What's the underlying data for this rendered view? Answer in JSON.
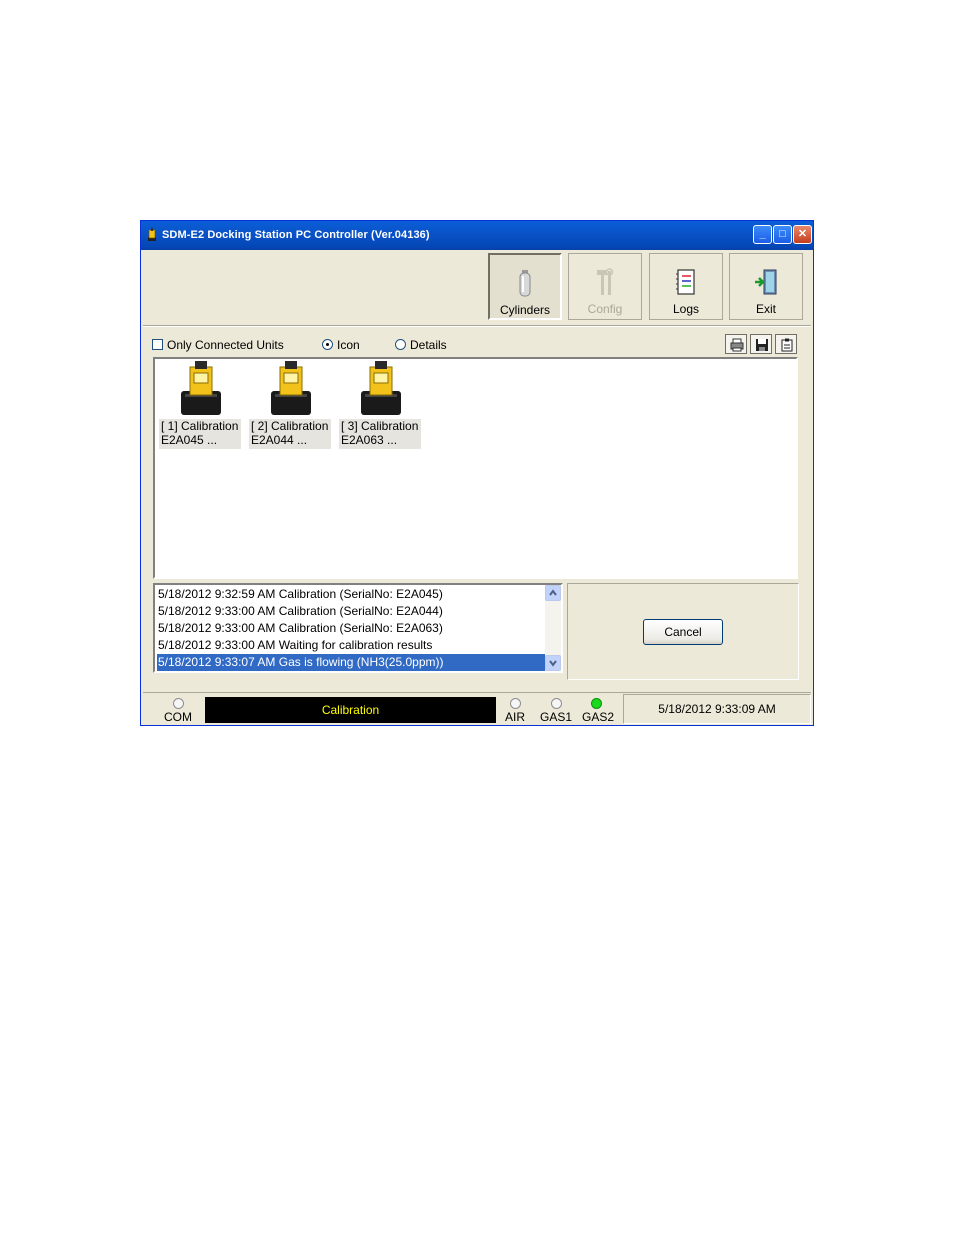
{
  "window": {
    "title": "SDM-E2 Docking Station PC Controller (Ver.04136)",
    "controls": [
      "minimize",
      "maximize",
      "close"
    ]
  },
  "toolbar": {
    "buttons": [
      {
        "label": "Cylinders",
        "icon": "cylinder-icon",
        "state": "pressed"
      },
      {
        "label": "Config",
        "icon": "tools-icon",
        "state": "disabled"
      },
      {
        "label": "Logs",
        "icon": "logbook-icon",
        "state": "normal"
      },
      {
        "label": "Exit",
        "icon": "exit-door-icon",
        "state": "normal"
      }
    ]
  },
  "view_options": {
    "only_connected": {
      "label": "Only Connected Units",
      "checked": false
    },
    "icon": {
      "label": "Icon",
      "selected": true
    },
    "details": {
      "label": "Details",
      "selected": false
    },
    "actions": [
      "print-icon",
      "save-icon",
      "clipboard-icon"
    ]
  },
  "units": [
    {
      "line1": "[ 1] Calibration",
      "line2": "E2A045     ..."
    },
    {
      "line1": "[ 2] Calibration",
      "line2": "E2A044     ..."
    },
    {
      "line1": "[ 3] Calibration",
      "line2": "E2A063     ..."
    }
  ],
  "log": [
    {
      "text": "5/18/2012 9:32:59 AM Calibration (SerialNo: E2A045)",
      "selected": false
    },
    {
      "text": "5/18/2012 9:33:00 AM Calibration (SerialNo: E2A044)",
      "selected": false
    },
    {
      "text": "5/18/2012 9:33:00 AM Calibration (SerialNo: E2A063)",
      "selected": false
    },
    {
      "text": "5/18/2012 9:33:00 AM Waiting for calibration results",
      "selected": false
    },
    {
      "text": "5/18/2012 9:33:07 AM Gas is flowing (NH3(25.0ppm))",
      "selected": true
    }
  ],
  "cancel_label": "Cancel",
  "status": {
    "com_label": "COM",
    "state_text": "Calibration",
    "air_label": "AIR",
    "gas1_label": "GAS1",
    "gas2_label": "GAS2",
    "gas2_active": true,
    "datetime": "5/18/2012 9:33:09 AM"
  },
  "colors": {
    "titlebar": "#0a53c9",
    "selection": "#316ac5",
    "status_text": "#ffff00",
    "led_on": "#1bd91b"
  }
}
